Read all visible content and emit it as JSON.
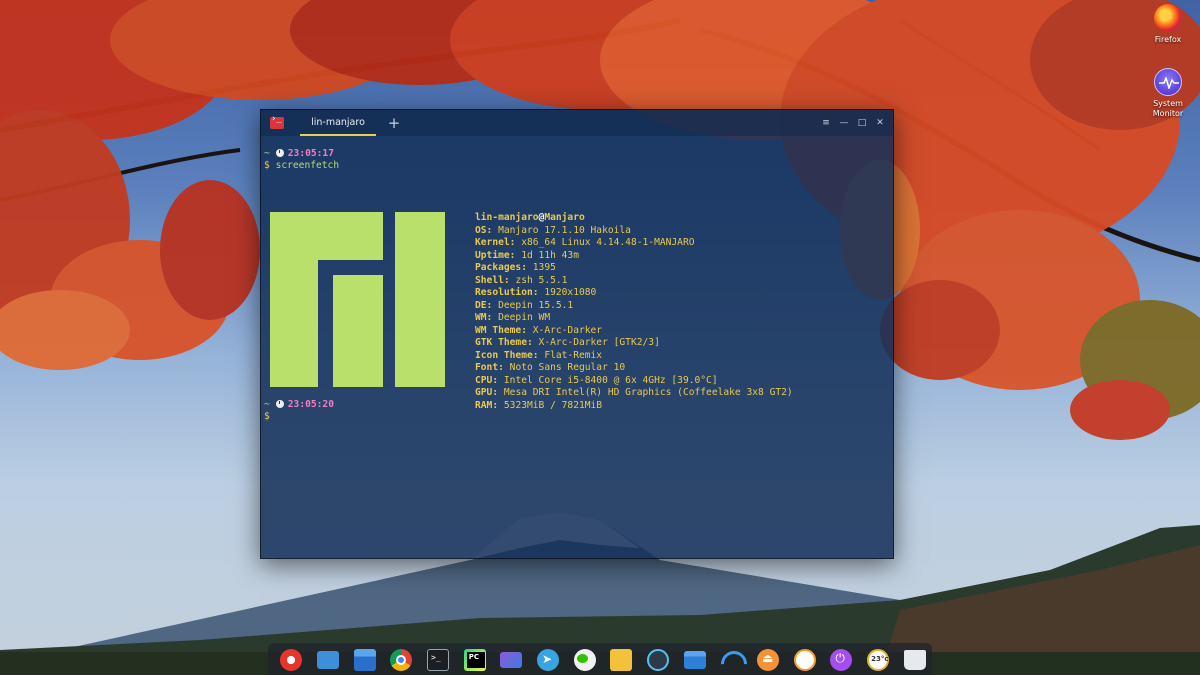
{
  "desktop": {
    "icons": [
      {
        "label": "Firefox",
        "icon": "firefox-icon"
      },
      {
        "label": "System\nMonitor",
        "icon": "system-monitor-icon"
      }
    ]
  },
  "terminal": {
    "tab_label": "lin-manjaro",
    "add_tab_glyph": "+",
    "controls": {
      "menu": "≡",
      "minimize": "—",
      "maximize": "□",
      "close": "✕"
    },
    "prompt1": {
      "tilde": "~",
      "time": "23:05:17",
      "dollar": "$",
      "command": "screenfetch"
    },
    "prompt2": {
      "tilde": "~",
      "time": "23:05:20",
      "dollar": "$"
    },
    "user": "lin-manjaro",
    "at": "@",
    "host": "Manjaro",
    "logo_color": "#b8e06a",
    "info": [
      {
        "key": "OS:",
        "value": "Manjaro 17.1.10 Hakoila"
      },
      {
        "key": "Kernel:",
        "value": "x86_64 Linux 4.14.48-1-MANJARO"
      },
      {
        "key": "Uptime:",
        "value": "1d 11h 43m"
      },
      {
        "key": "Packages:",
        "value": "1395"
      },
      {
        "key": "Shell:",
        "value": "zsh 5.5.1"
      },
      {
        "key": "Resolution:",
        "value": "1920x1080"
      },
      {
        "key": "DE:",
        "value": "Deepin 15.5.1"
      },
      {
        "key": "WM:",
        "value": "Deepin WM"
      },
      {
        "key": "WM Theme:",
        "value": "X-Arc-Darker"
      },
      {
        "key": "GTK Theme:",
        "value": "X-Arc-Darker [GTK2/3]"
      },
      {
        "key": "Icon Theme:",
        "value": "Flat-Remix"
      },
      {
        "key": "Font:",
        "value": "Noto Sans Regular 10"
      },
      {
        "key": "CPU:",
        "value": "Intel Core i5-8400 @ 6x 4GHz [39.0°C]"
      },
      {
        "key": "GPU:",
        "value": "Mesa DRI Intel(R) HD Graphics (Coffeelake 3x8 GT2)"
      },
      {
        "key": "RAM:",
        "value": "5323MiB / 7821MiB"
      }
    ]
  },
  "dock": {
    "items": [
      "launcher-icon",
      "multitasking-view-icon",
      "file-manager-icon",
      "chrome-icon",
      "terminal-icon",
      "pycharm-icon",
      "remote-desktop-icon",
      "telegram-icon",
      "wechat-icon",
      "notes-icon",
      "music-player-icon",
      "folder-icon",
      "wifi-icon",
      "usb-eject-icon",
      "clock-icon",
      "power-icon",
      "weather-icon",
      "trash-icon"
    ],
    "weather_text": "23°c"
  },
  "colors": {
    "prompt_time": "#f27ec0",
    "prompt_dollar": "#e9c94c",
    "command": "#b9d874",
    "info_text": "#e9c94c",
    "tab_underline": "#e8d24a"
  }
}
